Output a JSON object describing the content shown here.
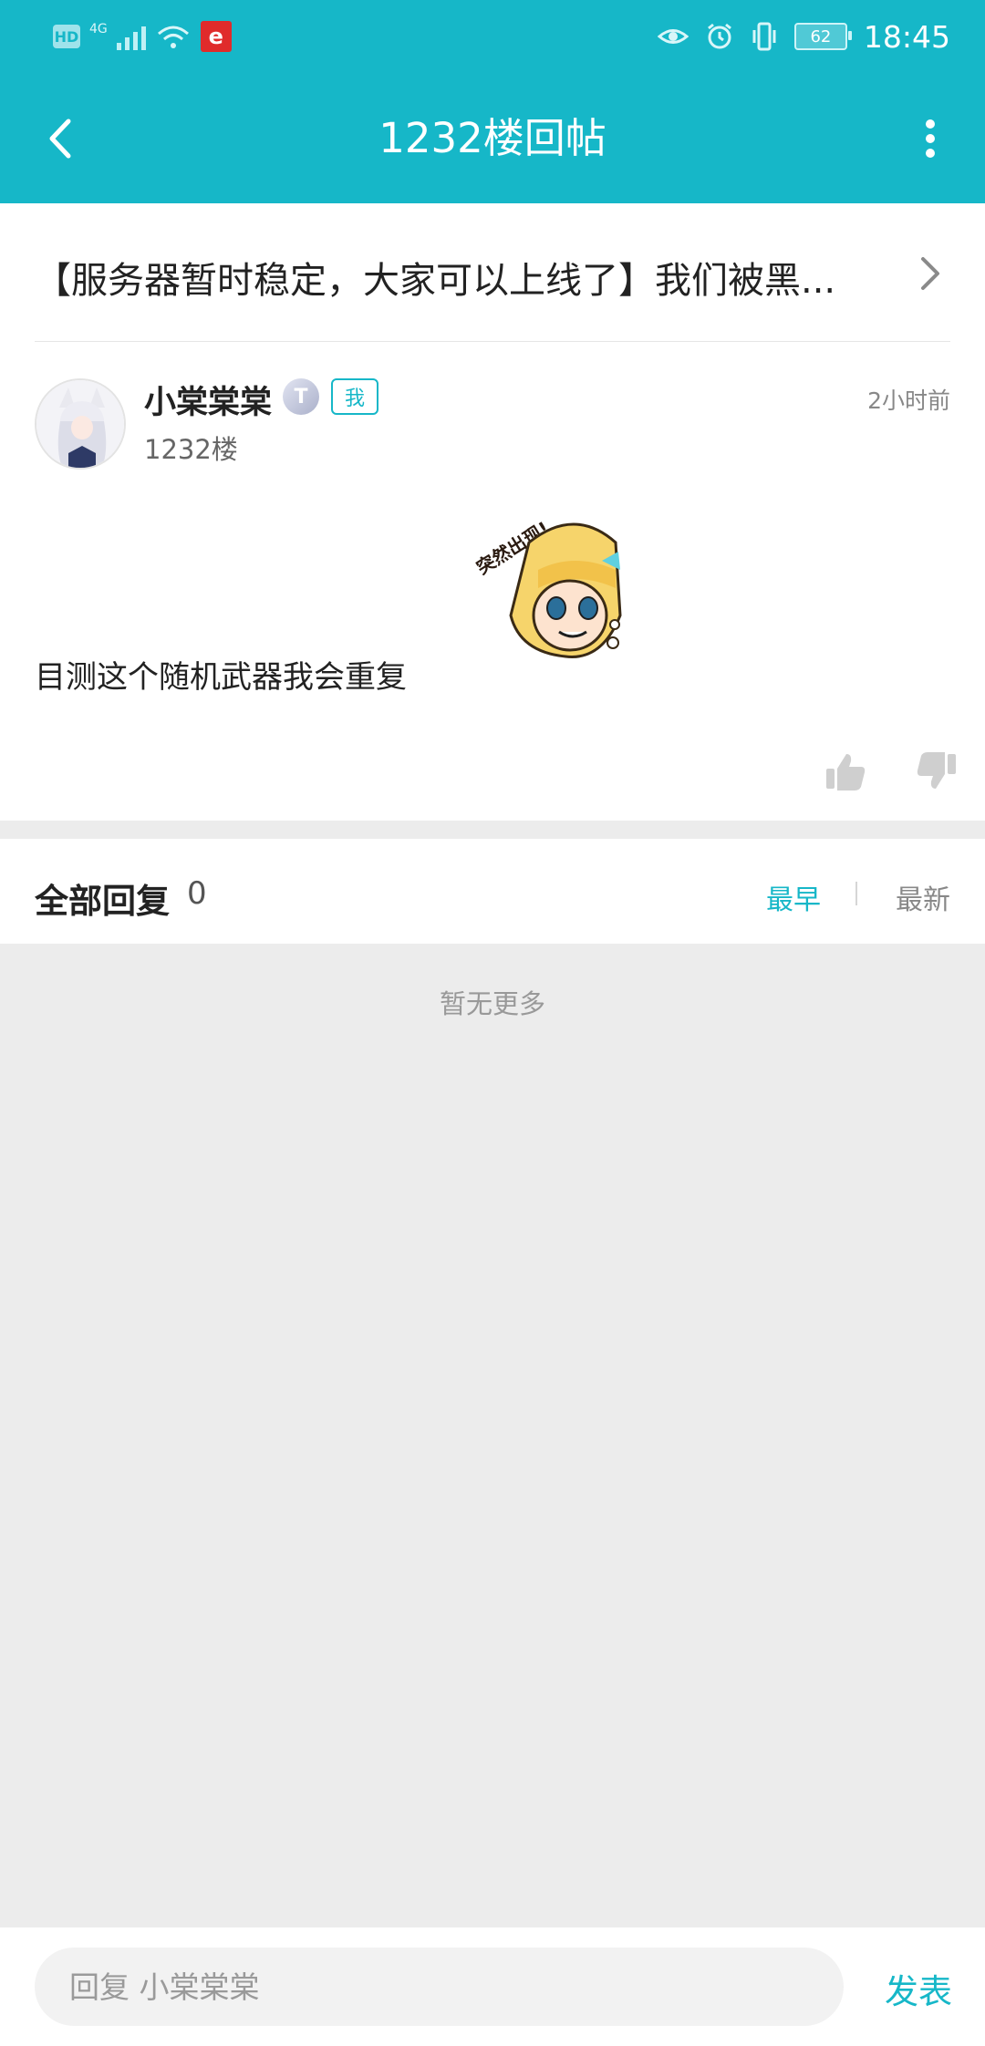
{
  "status_bar": {
    "hd_label": "HD",
    "network_label": "4G",
    "app_badge_label": "e",
    "battery_level": "62",
    "time": "18:45"
  },
  "toolbar": {
    "title": "1232楼回帖"
  },
  "thread": {
    "title": "【服务器暂时稳定，大家可以上线了】我们被黑..."
  },
  "post": {
    "username": "小棠棠棠",
    "level_badge": "T",
    "me_tag": "我",
    "time": "2小时前",
    "floor": "1232楼",
    "content": "目测这个随机武器我会重复",
    "sticker_text": "突然出现!"
  },
  "replies": {
    "title": "全部回复",
    "count": "0",
    "sort_earliest": "最早",
    "sort_latest": "最新",
    "empty_text": "暂无更多"
  },
  "reply_bar": {
    "placeholder": "回复 小棠棠棠",
    "send_label": "发表"
  },
  "colors": {
    "accent": "#16b7c8",
    "background": "#ececec",
    "card": "#ffffff"
  }
}
